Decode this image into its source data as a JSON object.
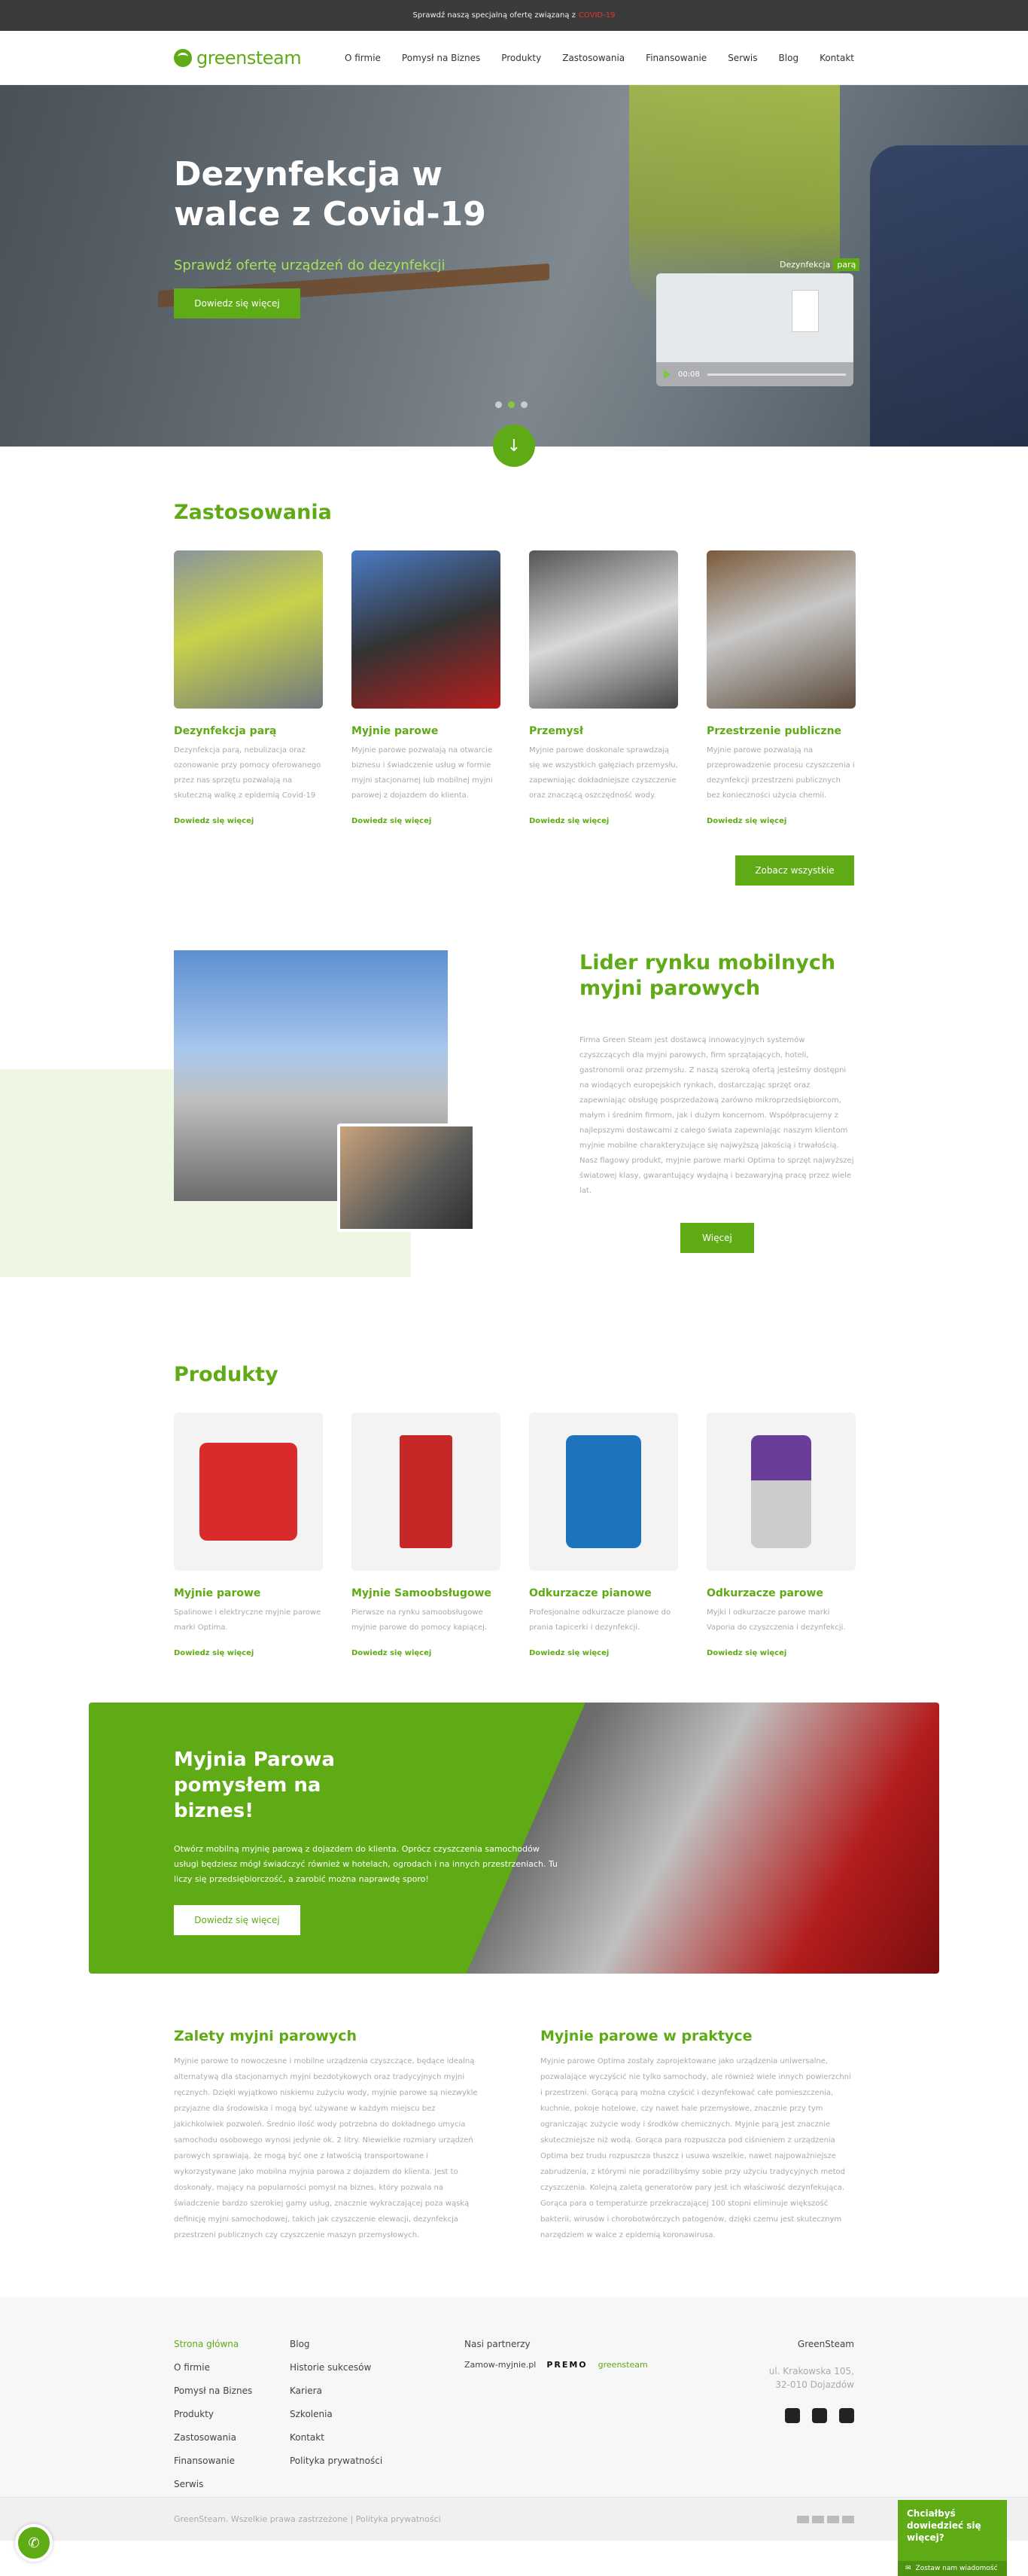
{
  "topbar": {
    "text": "Sprawdź naszą specjalną ofertę związaną z",
    "highlight": "COVID-19"
  },
  "header": {
    "logo": "greensteam",
    "nav": [
      "O firmie",
      "Pomysł na Biznes",
      "Produkty",
      "Zastosowania",
      "Finansowanie",
      "Serwis",
      "Blog",
      "Kontakt"
    ]
  },
  "hero": {
    "title": "Dezynfekcja w walce z Covid-19",
    "subtitle": "Sprawdź ofertę urządzeń do dezynfekcji",
    "cta": "Dowiedz się więcej",
    "video_label": "Dezynfekcja",
    "video_tag": "parą",
    "video_time": "00:08"
  },
  "zastosowania": {
    "title": "Zastosowania",
    "items": [
      {
        "title": "Dezynfekcja parą",
        "text": "Dezynfekcja parą, nebulizacja oraz ozonowanie przy pomocy oferowanego przez nas sprzętu pozwalają na skuteczną walkę z epidemią Covid-19",
        "more": "Dowiedz się więcej"
      },
      {
        "title": "Myjnie parowe",
        "text": "Myjnie parowe pozwalają na otwarcie biznesu i świadczenie usług w formie myjni stacjonarnej lub mobilnej myjni parowej z dojazdem do klienta.",
        "more": "Dowiedz się więcej"
      },
      {
        "title": "Przemysł",
        "text": "Myjnie parowe doskonale sprawdzają się we wszystkich gałęziach przemysłu, zapewniając dokładniejsze czyszczenie oraz znaczącą oszczędność wody.",
        "more": "Dowiedz się więcej"
      },
      {
        "title": "Przestrzenie publiczne",
        "text": "Myjnie parowe pozwalają na przeprowadzenie procesu czyszczenia i dezynfekcji przestrzeni publicznych bez konieczności użycia chemii.",
        "more": "Dowiedz się więcej"
      }
    ],
    "see_all": "Zobacz wszystkie"
  },
  "lider": {
    "title": "Lider rynku mobilnych myjni parowych",
    "text": "Firma Green Steam jest dostawcą innowacyjnych systemów czyszczących dla myjni parowych, firm sprzątających, hoteli, gastronomii oraz przemysłu. Z naszą szeroką ofertą jesteśmy dostępni na wiodących europejskich rynkach, dostarczając sprzęt oraz zapewniając obsługę posprzedażową zarówno mikroprzedsiębiorcom, małym i średnim firmom, jak i dużym koncernom. Współpracujemy z najlepszymi dostawcami z całego świata zapewniając naszym klientom myjnie mobilne charakteryzujące się najwyższą jakością i trwałością. Nasz flagowy produkt, myjnie parowe marki Optima to sprzęt najwyższej światowej klasy, gwarantujący wydajną i bezawaryjną pracę przez wiele lat.",
    "cta": "Więcej"
  },
  "produkty": {
    "title": "Produkty",
    "items": [
      {
        "title": "Myjnie parowe",
        "text": "Spalinowe i elektryczne myjnie parowe marki Optima.",
        "more": "Dowiedz się więcej",
        "color": "#d92b2b"
      },
      {
        "title": "Myjnie Samoobsługowe",
        "text": "Pierwsze na rynku samoobsługowe myjnie parowe do pomocy kapiącej.",
        "more": "Dowiedz się więcej",
        "color": "#c62828"
      },
      {
        "title": "Odkurzacze pianowe",
        "text": "Profesjonalne odkurzacze pianowe do prania tapicerki i dezynfekcji.",
        "more": "Dowiedz się więcej",
        "color": "#1e73be"
      },
      {
        "title": "Odkurzacze parowe",
        "text": "Myjki i odkurzacze parowe marki Vaporia do czyszczenia i dezynfekcji.",
        "more": "Dowiedz się więcej",
        "color": "#6a3d9a"
      }
    ]
  },
  "biznes": {
    "title": "Myjnia Parowa pomysłem na biznes!",
    "text": "Otwórz mobilną myjnię parową z dojazdem do klienta. Oprócz czyszczenia samochodów usługi będziesz mógł świadczyć również w hotelach, ogrodach i na innych przestrzeniach. Tu liczy się przedsiębiorczość, a zarobić można naprawdę sporo!",
    "cta": "Dowiedz się więcej"
  },
  "zalety": {
    "title": "Zalety myjni parowych",
    "text": "Myjnie parowe to nowoczesne i mobilne urządzenia czyszczące, będące idealną alternatywą dla stacjonarnych myjni bezdotykowych oraz tradycyjnych myjni ręcznych. Dzięki wyjątkowo niskiemu zużyciu wody, myjnie parowe są niezwykle przyjazne dla środowiska i mogą być używane w każdym miejscu bez jakichkolwiek pozwoleń. Średnio ilość wody potrzebna do dokładnego umycia samochodu osobowego wynosi jedynie ok. 2 litry. Niewielkie rozmiary urządzeń parowych sprawiają, że mogą być one z łatwością transportowane i wykorzystywane jako mobilna myjnia parowa z dojazdem do klienta. Jest to doskonały, mający na popularności pomysł na biznes, który pozwala na świadczenie bardzo szerokiej gamy usług, znacznie wykraczającej poza wąską definicję myjni samochodowej, takich jak czyszczenie elewacji, dezynfekcja przestrzeni publicznych czy czyszczenie maszyn przemysłowych."
  },
  "praktyka": {
    "title": "Myjnie parowe w praktyce",
    "text": "Myjnie parowe Optima zostały zaprojektowane jako urządzenia uniwersalne, pozwalające wyczyścić nie tylko samochody, ale również wiele innych powierzchni i przestrzeni. Gorącą parą można czyścić i dezynfekować całe pomieszczenia, kuchnie, pokoje hotelowe, czy nawet hale przemysłowe, znacznie przy tym ograniczając zużycie wody i środków chemicznych. Myjnie parą jest znacznie skuteczniejsze niż wodą. Gorąca para rozpuszcza pod ciśnieniem z urządzenia Optima bez trudu rozpuszcza tłuszcz i usuwa wszelkie, nawet najpoważniejsze zabrudzenia, z którymi nie poradzilibyśmy sobie przy użyciu tradycyjnych metod czyszczenia. Kolejną zaletą generatorów pary jest ich właściwość dezynfekująca. Gorąca para o temperaturze przekraczającej 100 stopni eliminuje większość bakterii, wirusów i chorobotwórczych patogenów, dzięki czemu jest skutecznym narzędziem w walce z epidemią koronawirusa."
  },
  "footer": {
    "col1": [
      "Strona główna",
      "O firmie",
      "Pomysł na Biznes",
      "Produkty",
      "Zastosowania",
      "Finansowanie",
      "Serwis"
    ],
    "col2": [
      "Blog",
      "Historie sukcesów",
      "Kariera",
      "Szkolenia",
      "Kontakt",
      "Polityka prywatności"
    ],
    "partners_title": "Nasi partnerzy",
    "partners": [
      "Zamow-myjnie.pl",
      "PREMO",
      "greensteam"
    ],
    "company": "GreenSteam",
    "addr1": "ul. Krakowska 105,",
    "addr2": "32-010 Dojazdów",
    "copyright": "GreenSteam. Wszelkie prawa zastrzeżone | Polityka prywatności"
  },
  "chat": {
    "title": "Chciałbyś dowiedzieć się więcej?",
    "sub": "Zostaw nam wiadomość"
  }
}
